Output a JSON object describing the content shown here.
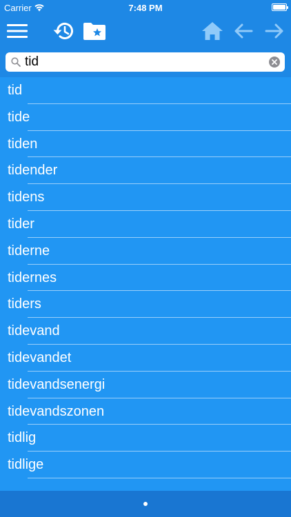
{
  "status_bar": {
    "carrier": "Carrier",
    "time": "7:48 PM",
    "icons": [
      "wifi-icon",
      "battery-icon"
    ]
  },
  "toolbar": {
    "icons": [
      "menu-icon",
      "history-icon",
      "favorites-folder-icon",
      "home-icon",
      "back-arrow-icon",
      "forward-arrow-icon"
    ]
  },
  "search": {
    "value": "tid",
    "icons": [
      "search-icon",
      "clear-icon"
    ]
  },
  "results": [
    "tid",
    "tide",
    "tiden",
    "tidender",
    "tidens",
    "tider",
    "tiderne",
    "tidernes",
    "tiders",
    "tidevand",
    "tidevandet",
    "tidevandsenergi",
    "tidevandszonen",
    "tidlig",
    "tidlige"
  ],
  "colors": {
    "background": "#2196F3",
    "toolbar": "#1E88E5",
    "bottom_bar": "#1976D2",
    "text": "#ffffff"
  }
}
